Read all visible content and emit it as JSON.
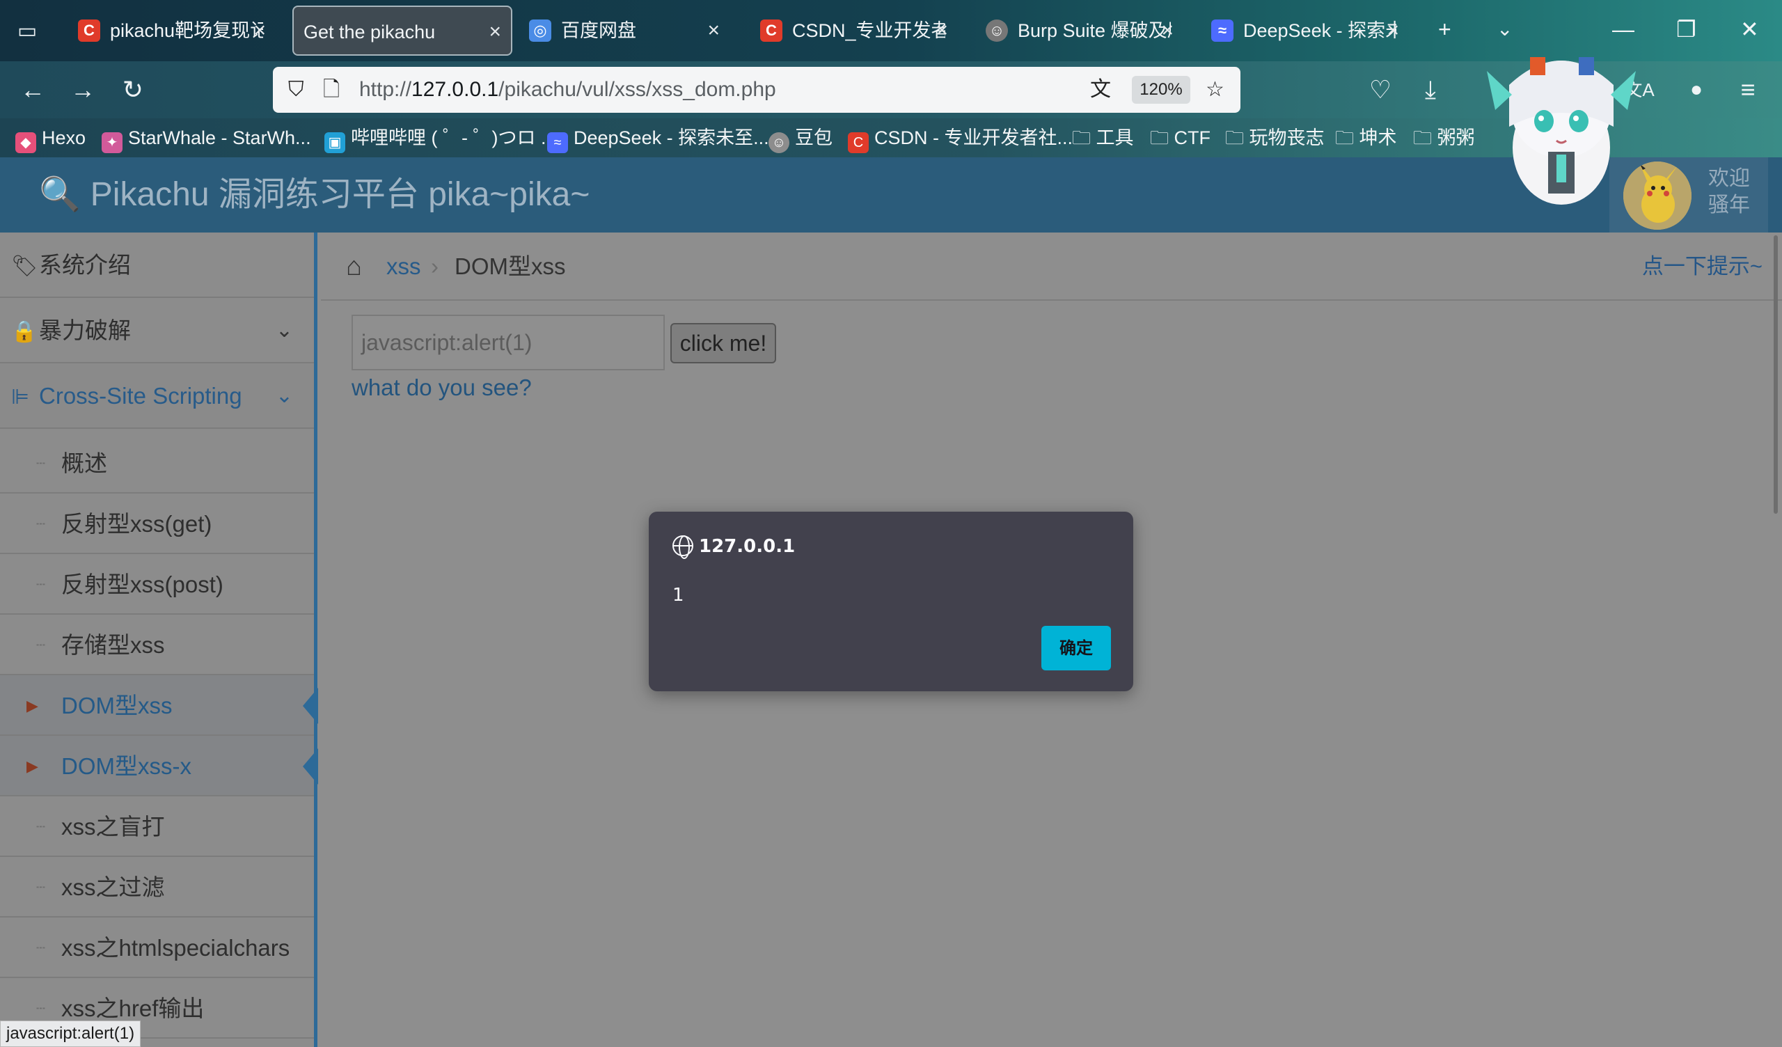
{
  "browser": {
    "tabs": [
      {
        "label": "pikachu靶场复现记",
        "icon": "csdn-icon",
        "icon_char": "C",
        "color": "#e03b2a"
      },
      {
        "label": "Get the pikachu",
        "icon": "",
        "icon_char": "",
        "color": ""
      },
      {
        "label": "百度网盘",
        "icon": "baidu-netdisk-icon",
        "icon_char": "◎",
        "color": "#4a8ce6"
      },
      {
        "label": "CSDN_专业开发者社",
        "icon": "csdn-icon",
        "icon_char": "C",
        "color": "#e03b2a"
      },
      {
        "label": "Burp Suite 爆破及原",
        "icon": "avatar-icon",
        "icon_char": "☺",
        "color": "#777"
      },
      {
        "label": "DeepSeek - 探索未",
        "icon": "deepseek-icon",
        "icon_char": "≈",
        "color": "#4d6bfe"
      }
    ],
    "new_tab": "+",
    "url_prefix": "http://",
    "url_host": "127.0.0.1",
    "url_path": "/pikachu/vul/xss/xss_dom.php",
    "zoom": "120%",
    "bookmarks": [
      {
        "label": "Hexo",
        "icon": "hexo-icon",
        "color": "#e6507a"
      },
      {
        "label": "StarWhale - StarWh...",
        "icon": "starwhale-icon",
        "color": "#d25a9a"
      },
      {
        "label": "哔哩哔哩 ( ゜- ゜)つロ ...",
        "icon": "bilibili-icon",
        "color": "#21a0d6"
      },
      {
        "label": "DeepSeek - 探索未至...",
        "icon": "deepseek-icon",
        "color": "#4d6bfe"
      },
      {
        "label": "豆包",
        "icon": "doubao-icon",
        "color": "#8d8d8d"
      },
      {
        "label": "CSDN - 专业开发者社...",
        "icon": "csdn-icon",
        "color": "#e03b2a"
      },
      {
        "label": "工具",
        "icon": "folder-icon",
        "color": ""
      },
      {
        "label": "CTF",
        "icon": "folder-icon",
        "color": ""
      },
      {
        "label": "玩物丧志",
        "icon": "folder-icon",
        "color": ""
      },
      {
        "label": "坤术",
        "icon": "folder-icon",
        "color": ""
      },
      {
        "label": "粥粥",
        "icon": "folder-icon",
        "color": ""
      }
    ],
    "status_text": "javascript:alert(1)"
  },
  "site": {
    "title": "Pikachu 漏洞练习平台 pika~pika~",
    "welcome_line1": "欢迎",
    "welcome_line2": "骚年",
    "header_color": "#2b5c7b"
  },
  "sidebar": {
    "intro": "系统介绍",
    "brute": "暴力破解",
    "xss": "Cross-Site Scripting",
    "xss_items": [
      {
        "label": "概述"
      },
      {
        "label": "反射型xss(get)"
      },
      {
        "label": "反射型xss(post)"
      },
      {
        "label": "存储型xss"
      },
      {
        "label": "DOM型xss"
      },
      {
        "label": "DOM型xss-x"
      },
      {
        "label": "xss之盲打"
      },
      {
        "label": "xss之过滤"
      },
      {
        "label": "xss之htmlspecialchars"
      },
      {
        "label": "xss之href输出"
      }
    ]
  },
  "main": {
    "breadcrumb_parent": "xss",
    "breadcrumb_sep": "›",
    "breadcrumb_current": "DOM型xss",
    "hint": "点一下提示~",
    "input_value": "javascript:alert(1)",
    "button_label": "click me!",
    "link_text": "what do you see?"
  },
  "alert": {
    "origin": "127.0.0.1",
    "message": "1",
    "ok_label": "确定",
    "ok_color": "#00b3d6"
  }
}
